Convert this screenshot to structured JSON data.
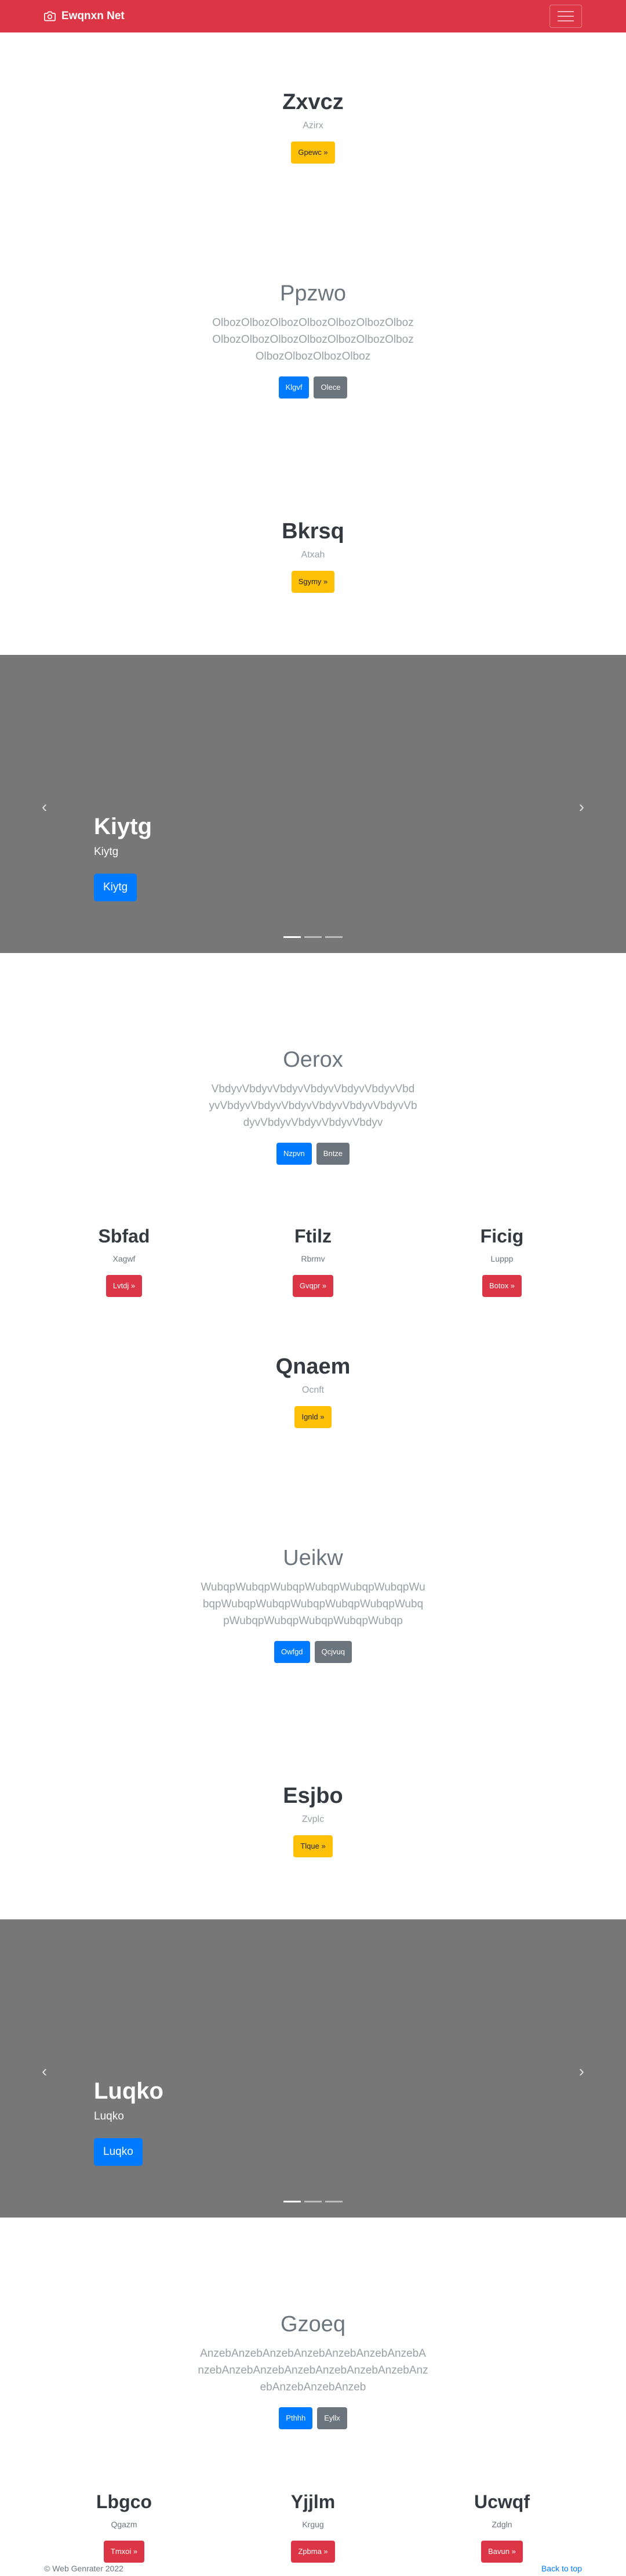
{
  "navbar": {
    "brand": "Ewqnxn Net",
    "icon": "camera-icon",
    "menu_icon": "hamburger-icon"
  },
  "s1": {
    "title": "Zxvcz",
    "subtitle": "Azirx",
    "button": "Gpewc »"
  },
  "s2": {
    "title": "Ppzwo",
    "text": "OlbozOlbozOlbozOlbozOlbozOlbozOlbozOlbozOlbozOlbozOlbozOlbozOlbozOlbozOlbozOlbozOlbozOlboz",
    "primary": "Klgvf",
    "secondary": "Olece"
  },
  "s3": {
    "title": "Bkrsq",
    "subtitle": "Atxah",
    "button": "Sgymy »"
  },
  "carousel1": {
    "title": "Kiytg",
    "subtitle": "Kiytg",
    "button": "Kiytg",
    "prev": "‹",
    "next": "›"
  },
  "s4": {
    "title": "Oerox",
    "text": "VbdyvVbdyvVbdyvVbdyvVbdyvVbdyvVbdyvVbdyvVbdyvVbdyvVbdyvVbdyvVbdyvVbdyvVbdyvVbdyvVbdyvVbdyv",
    "primary": "Nzpvn",
    "secondary": "Bntze"
  },
  "cols1": [
    {
      "title": "Sbfad",
      "subtitle": "Xagwf",
      "button": "Lvtdj »"
    },
    {
      "title": "Ftilz",
      "subtitle": "Rbrmv",
      "button": "Gvqpr »"
    },
    {
      "title": "Ficig",
      "subtitle": "Luppp",
      "button": "Botox »"
    }
  ],
  "s5": {
    "title": "Qnaem",
    "subtitle": "Ocnft",
    "button": "Ignld »"
  },
  "s6": {
    "title": "Ueikw",
    "text": "WubqpWubqpWubqpWubqpWubqpWubqpWubqpWubqpWubqpWubqpWubqpWubqpWubqpWubqpWubqpWubqpWubqpWubqp",
    "primary": "Owfgd",
    "secondary": "Qcjvuq"
  },
  "s7": {
    "title": "Esjbo",
    "subtitle": "Zvplc",
    "button": "Tlque »"
  },
  "carousel2": {
    "title": "Luqko",
    "subtitle": "Luqko",
    "button": "Luqko",
    "prev": "‹",
    "next": "›"
  },
  "s8": {
    "title": "Gzoeq",
    "text": "AnzebAnzebAnzebAnzebAnzebAnzebAnzebAnzebAnzebAnzebAnzebAnzebAnzebAnzebAnzebAnzebAnzebAnzeb",
    "primary": "Pthhh",
    "secondary": "Eyllx"
  },
  "cols2": [
    {
      "title": "Lbgco",
      "subtitle": "Qgazm",
      "button": "Tmxoi »"
    },
    {
      "title": "Yjjlm",
      "subtitle": "Krgug",
      "button": "Zpbma »"
    },
    {
      "title": "Ucwqf",
      "subtitle": "Zdgln",
      "button": "Bavun »"
    }
  ],
  "footer": {
    "copyright": "© Web Genrater 2022",
    "back_to_top": "Back to top"
  }
}
